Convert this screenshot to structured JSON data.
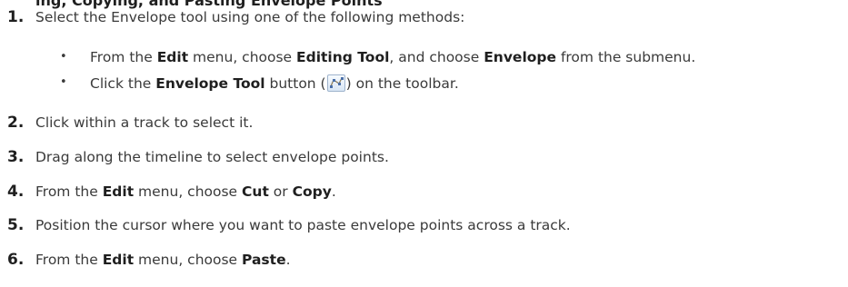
{
  "heading_partial": "ing, Copying, and Pasting Envelope Points",
  "steps": [
    {
      "number": "1.",
      "pre": "Select the Envelope tool using one of the following methods:"
    },
    {
      "number": "2.",
      "pre": "Click within a track to select it."
    },
    {
      "number": "3.",
      "pre": "Drag along the timeline to select envelope points."
    },
    {
      "number": "4.",
      "pre": "From the ",
      "b1": "Edit",
      "mid1": " menu, choose ",
      "b2": "Cut",
      "mid2": " or ",
      "b3": "Copy",
      "end": "."
    },
    {
      "number": "5.",
      "pre": "Position the cursor where you want to paste envelope points across a track."
    },
    {
      "number": "6.",
      "pre": "From the ",
      "b1": "Edit",
      "mid1": " menu, choose ",
      "b2": "Paste",
      "end": "."
    }
  ],
  "substeps": [
    {
      "bullet": "•",
      "pre": "From the ",
      "b1": "Edit",
      "mid1": " menu, choose ",
      "b2": "Editing Tool",
      "mid2": ", and choose ",
      "b3": "Envelope",
      "end": " from the submenu."
    },
    {
      "bullet": "•",
      "pre": "Click the ",
      "b1": "Envelope Tool",
      "mid1": " button (",
      "icon": "envelope-tool-icon",
      "end": ") on the toolbar."
    }
  ]
}
